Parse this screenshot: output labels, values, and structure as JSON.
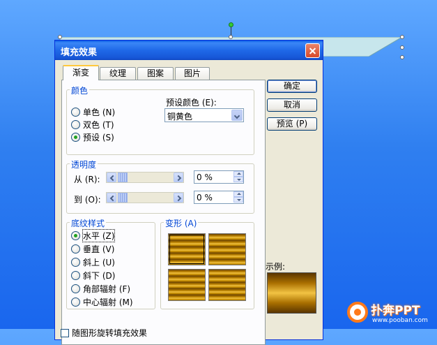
{
  "dialog": {
    "title": "填充效果"
  },
  "tabs": [
    {
      "label": "渐变",
      "active": true
    },
    {
      "label": "纹理",
      "active": false
    },
    {
      "label": "图案",
      "active": false
    },
    {
      "label": "图片",
      "active": false
    }
  ],
  "colors_group": {
    "label": "颜色",
    "options": [
      "单色 (N)",
      "双色 (T)",
      "预设 (S)"
    ],
    "selected_index": 2,
    "preset_label": "预设颜色 (E):",
    "preset_value": "铜黄色"
  },
  "transparency_group": {
    "label": "透明度",
    "from_label": "从 (R):",
    "to_label": "到 (O):",
    "from_value": "0 %",
    "to_value": "0 %"
  },
  "shading_group": {
    "label": "底纹样式",
    "options": [
      "水平 (Z)",
      "垂直 (V)",
      "斜上 (U)",
      "斜下 (D)",
      "角部辐射 (F)",
      "中心辐射 (M)"
    ],
    "selected_index": 0
  },
  "variants_group": {
    "label": "变形 (A)"
  },
  "buttons": {
    "ok": "确定",
    "cancel": "取消",
    "preview": "预览 (P)"
  },
  "sample": {
    "label": "示例:"
  },
  "bottom_checkbox": {
    "label": "随图形旋转填充效果"
  },
  "watermark": {
    "name": "扑奔PPT",
    "url": "www.pooban.com"
  },
  "colors": {
    "title_bar": "#1f69e8",
    "dialog_bg": "#ece9d8",
    "group_label": "#0046d5",
    "gradient_gold": "#f2c343"
  }
}
